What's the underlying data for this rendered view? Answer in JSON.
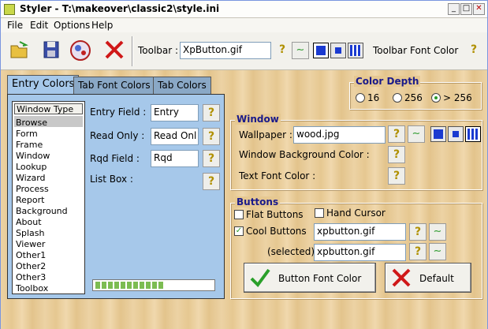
{
  "titlebar": {
    "title": "Styler - T:\\makeover\\classic2\\style.ini",
    "min": "_",
    "max": "□",
    "close": "✕"
  },
  "menu": [
    "File",
    "Edit",
    "Options",
    "Help"
  ],
  "toolbar": {
    "toolbar_label": "Toolbar :",
    "toolbar_value": "XpButton.gif",
    "font_color_label": "Toolbar Font Color"
  },
  "tabs": [
    "Entry Colors",
    "Tab Font Colors",
    "Tab Colors"
  ],
  "window_type": {
    "header": "Window Type",
    "items": [
      "Browse",
      "Form",
      "Frame",
      "Window",
      "Lookup",
      "Wizard",
      "Process",
      "Report",
      "Background",
      "About",
      "Splash",
      "Viewer",
      "Other1",
      "Other2",
      "Other3",
      "Toolbox"
    ],
    "selected": "Browse"
  },
  "entry": {
    "entry_label": "Entry Field :",
    "entry_value": "Entry",
    "readonly_label": "Read Only :",
    "readonly_value": "Read Onl",
    "rqd_label": "Rqd Field :",
    "rqd_value": "Rqd",
    "listbox_label": "List Box :"
  },
  "progress": {
    "blocks": 11
  },
  "color_depth": {
    "title": "Color Depth",
    "options": [
      "16",
      "256",
      "> 256"
    ],
    "selected": "> 256"
  },
  "window_group": {
    "title": "Window",
    "wallpaper_label": "Wallpaper :",
    "wallpaper_value": "wood.jpg",
    "bg_color_label": "Window Background Color :",
    "text_color_label": "Text Font Color :"
  },
  "buttons_group": {
    "title": "Buttons",
    "flat_label": "Flat Buttons",
    "flat_checked": false,
    "hand_label": "Hand Cursor",
    "hand_checked": false,
    "cool_label": "Cool Buttons",
    "cool_checked": true,
    "cool_value": "xpbutton.gif",
    "selected_label": "(selected)",
    "selected_value": "xpbutton.gif",
    "font_color_btn": "Button Font Color",
    "default_btn": "Default"
  },
  "icons": {
    "question": "?",
    "wave": "∼"
  }
}
